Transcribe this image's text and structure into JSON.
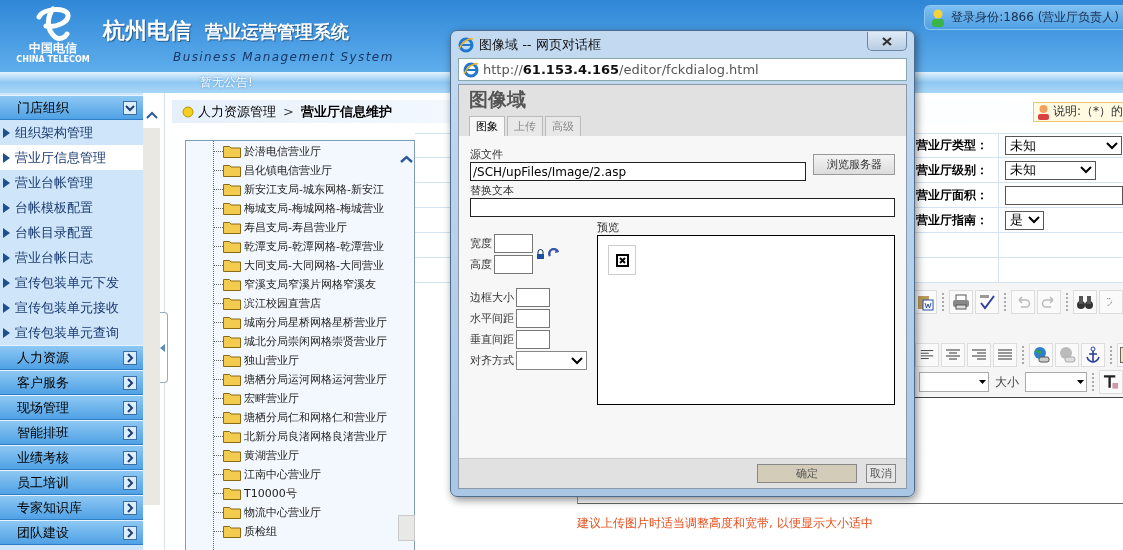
{
  "header": {
    "logo_text": "中国电信",
    "logo_caption": "CHINA TELECOM",
    "title": "杭州电信",
    "subtitle": "营业运营管理系统",
    "tagline": "Business Management System",
    "login": "登录身份:1866 (营业厅负责人)"
  },
  "notice": "暂无公告!",
  "sidebar": {
    "groups": [
      {
        "label": "门店组织",
        "expanded": true,
        "items": [
          {
            "label": "组织架构管理",
            "selected": false
          },
          {
            "label": "营业厅信息管理",
            "selected": true
          },
          {
            "label": "营业台帐管理",
            "selected": false
          },
          {
            "label": "台帐模板配置",
            "selected": false
          },
          {
            "label": "台帐目录配置",
            "selected": false
          },
          {
            "label": "营业台帐日志",
            "selected": false
          },
          {
            "label": "宣传包装单元下发",
            "selected": false
          },
          {
            "label": "宣传包装单元接收",
            "selected": false
          },
          {
            "label": "宣传包装单元查询",
            "selected": false
          }
        ]
      },
      {
        "label": "人力资源",
        "expanded": false
      },
      {
        "label": "客户服务",
        "expanded": false
      },
      {
        "label": "现场管理",
        "expanded": false
      },
      {
        "label": "智能排班",
        "expanded": false
      },
      {
        "label": "业绩考核",
        "expanded": false
      },
      {
        "label": "员工培训",
        "expanded": false
      },
      {
        "label": "专家知识库",
        "expanded": false
      },
      {
        "label": "团队建设",
        "expanded": false
      }
    ]
  },
  "breadcrumb": {
    "parent": "人力资源管理",
    "separator": ">",
    "current": "营业厅信息维护"
  },
  "hint": "说明:（*）的",
  "tree": {
    "items": [
      "於潜电信营业厅",
      "昌化镇电信营业厅",
      "新安江支局-城东网格-新安江",
      "梅城支局-梅城网格-梅城营业",
      "寿昌支局-寿昌营业厅",
      "乾潭支局-乾潭网格-乾潭营业",
      "大同支局-大同网格-大同营业",
      "窄溪支局窄溪片网格窄溪友",
      "滨江校园直营店",
      "城南分局星桥网格星桥营业厅",
      "城北分局崇闲网格崇贤营业厅",
      "独山营业厅",
      "塘栖分局运河网格运河营业厅",
      "宏畔营业厅",
      "塘栖分局仁和网格仁和营业厅",
      "北新分局良渚网格良渚营业厅",
      "黄湖营业厅",
      "江南中心营业厅",
      "T10000号",
      "物流中心营业厅",
      "质检组"
    ]
  },
  "form": {
    "fields": [
      {
        "label": "营业厅类型：",
        "kind": "select",
        "value": "未知"
      },
      {
        "label": "营业厅级别：",
        "kind": "select",
        "value": "未知"
      },
      {
        "label": "营业厅面积：",
        "kind": "input"
      },
      {
        "label": "营业厅指南：",
        "kind": "select",
        "value": "是"
      }
    ]
  },
  "editor": {
    "size_label": "大小"
  },
  "footnote": "建议上传图片时适当调整高度和宽带, 以便显示大小适中",
  "dialog": {
    "title": "图像域 -- 网页对话框",
    "url": "http://**61.153.4.165**/editor/fckdialog.html",
    "heading": "图像域",
    "tabs": [
      {
        "label": "图象",
        "selected": true
      },
      {
        "label": "上传",
        "selected": false
      },
      {
        "label": "高级",
        "selected": false
      }
    ],
    "source_label": "源文件",
    "source_value": "/SCH/upFiles/Image/2.asp",
    "browse_button": "浏览服务器",
    "alt_label": "替换文本",
    "size_fields": [
      "宽度",
      "高度"
    ],
    "spacing_fields": [
      "边框大小",
      "水平间距",
      "垂直间距"
    ],
    "align_label": "对齐方式",
    "preview_label": "预览",
    "buttons": [
      {
        "label": "确定",
        "kind": "primary"
      },
      {
        "label": "取消",
        "kind": "secondary"
      }
    ]
  }
}
